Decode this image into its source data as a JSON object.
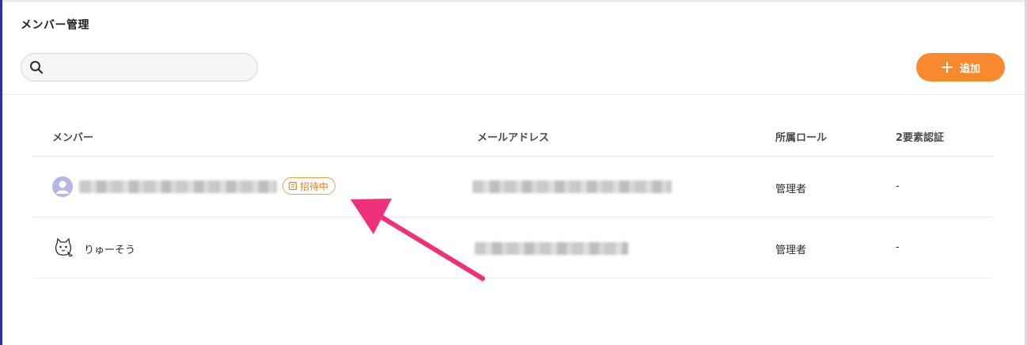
{
  "page": {
    "title": "メンバー管理"
  },
  "search": {
    "placeholder": "",
    "value": ""
  },
  "toolbar": {
    "add_label": "追加"
  },
  "table": {
    "columns": [
      "メンバー",
      "メールアドレス",
      "所属ロール",
      "2要素認証"
    ],
    "rows": [
      {
        "member": "",
        "badge": "招待中",
        "email": "",
        "role": "管理者",
        "two_factor": "-",
        "avatar": "default-user-icon"
      },
      {
        "member": "りゅーそう",
        "badge": "",
        "email": "",
        "role": "管理者",
        "two_factor": "-",
        "avatar": "cat-avatar-icon"
      }
    ]
  },
  "colors": {
    "accent": "#f9892f",
    "badge": "#e8842a",
    "annotation_arrow": "#f0307a",
    "avatar_bg": "#b7b4e6"
  }
}
